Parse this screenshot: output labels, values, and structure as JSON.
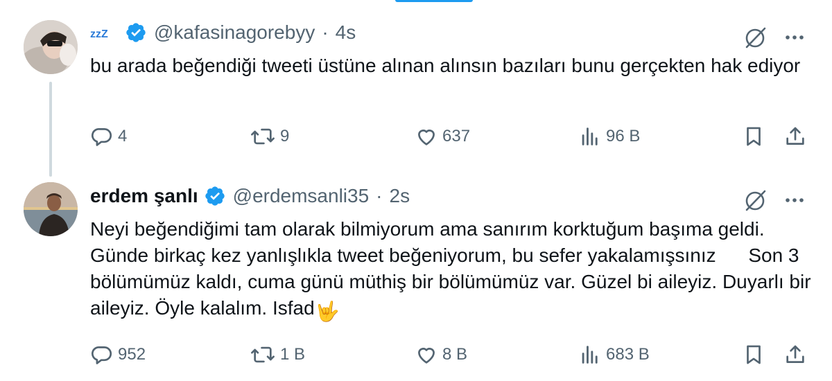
{
  "tweets": [
    {
      "display_name": "",
      "name_glyph": "zzZ",
      "handle": "@kafasinagorebyy",
      "time": "4s",
      "text": "bu arada beğendiği tweeti üstüne alınan alınsın bazıları bunu gerçekten hak ediyor",
      "emoji": "",
      "replies": "4",
      "retweets": "9",
      "likes": "637",
      "views": "96 B"
    },
    {
      "display_name": "erdem şanlı",
      "handle": "@erdemsanli35",
      "time": "2s",
      "text": "Neyi beğendiğimi tam olarak bilmiyorum ama sanırım korktuğum başıma geldi. Günde birkaç kez yanlışlıkla tweet beğeniyorum, bu sefer yakalamışsınız      Son 3 bölümümüz kaldı, cuma günü müthiş bir bölümümüz var. Güzel bi aileyiz. Duyarlı bir aileyiz. Öyle kalalım. Isfad",
      "emoji": "🤟",
      "replies": "952",
      "retweets": "1 B",
      "likes": "8 B",
      "views": "683 B"
    }
  ],
  "colors": {
    "accent": "#1d9bf0",
    "muted": "#536471",
    "text": "#0f1419",
    "thread_line": "#cfd9de"
  },
  "icons": [
    "verified-badge-icon",
    "grok-icon",
    "more-icon",
    "reply-icon",
    "retweet-icon",
    "like-icon",
    "views-icon",
    "bookmark-icon",
    "share-icon"
  ]
}
